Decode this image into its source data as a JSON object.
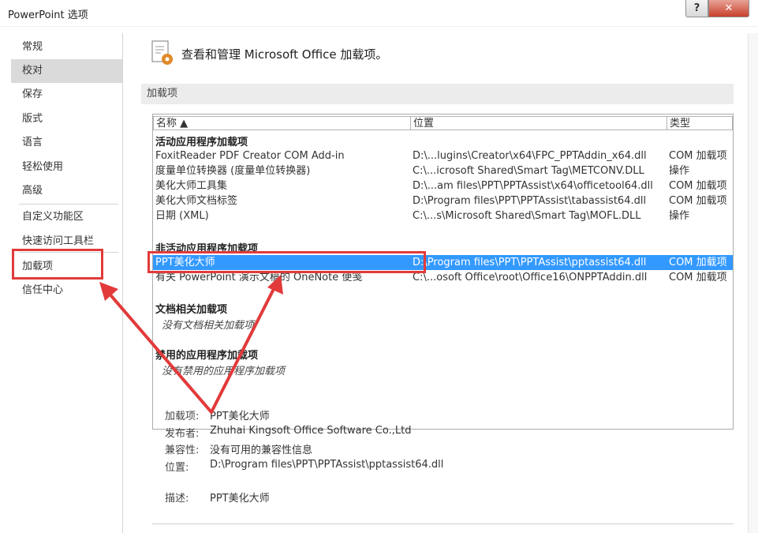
{
  "window": {
    "title": "PowerPoint 选项",
    "help_label": "?",
    "close_label": "✕"
  },
  "nav": {
    "items": [
      {
        "label": "常规"
      },
      {
        "label": "校对"
      },
      {
        "label": "保存"
      },
      {
        "label": "版式"
      },
      {
        "label": "语言"
      },
      {
        "label": "轻松使用"
      },
      {
        "label": "高级"
      },
      {
        "label": "自定义功能区"
      },
      {
        "label": "快速访问工具栏"
      },
      {
        "label": "加载项"
      },
      {
        "label": "信任中心"
      }
    ],
    "active_index": 1
  },
  "main": {
    "header_title": "查看和管理 Microsoft Office 加载项。",
    "section_title": "加载项",
    "columns": {
      "name": "名称 ▲",
      "location": "位置",
      "type": "类型"
    },
    "groups": {
      "active": {
        "label": "活动应用程序加载项",
        "rows": [
          {
            "name": "FoxitReader PDF Creator COM Add-in",
            "location": "D:\\...lugins\\Creator\\x64\\FPC_PPTAddin_x64.dll",
            "type": "COM 加载项"
          },
          {
            "name": "度量单位转换器 (度量单位转换器)",
            "location": "C:\\...icrosoft Shared\\Smart Tag\\METCONV.DLL",
            "type": "操作"
          },
          {
            "name": "美化大师工具集",
            "location": "D:\\...am files\\PPT\\PPTAssist\\x64\\officetool64.dll",
            "type": "COM 加载项"
          },
          {
            "name": "美化大师文档标签",
            "location": "D:\\Program files\\PPT\\PPTAssist\\tabassist64.dll",
            "type": "COM 加载项"
          },
          {
            "name": "日期 (XML)",
            "location": "C:\\...s\\Microsoft Shared\\Smart Tag\\MOFL.DLL",
            "type": "操作"
          }
        ]
      },
      "inactive": {
        "label": "非活动应用程序加载项",
        "rows": [
          {
            "name": "PPT美化大师",
            "location": "D:\\Program files\\PPT\\PPTAssist\\pptassist64.dll",
            "type": "COM 加载项"
          },
          {
            "name": "有关 PowerPoint 演示文稿的 OneNote 便笺",
            "location": "C:\\...osoft Office\\root\\Office16\\ONPPTAddin.dll",
            "type": "COM 加载项"
          }
        ]
      },
      "document": {
        "label": "文档相关加载项",
        "empty_note": "没有文档相关加载项"
      },
      "disabled": {
        "label": "禁用的应用程序加载项",
        "empty_note": "没有禁用的应用程序加载项"
      }
    },
    "details": {
      "addin_label": "加载项:",
      "addin_value": "PPT美化大师",
      "publisher_label": "发布者:",
      "publisher_value": "Zhuhai Kingsoft Office Software Co.,Ltd",
      "compat_label": "兼容性:",
      "compat_value": "没有可用的兼容性信息",
      "location_label": "位置:",
      "location_value": "D:\\Program files\\PPT\\PPTAssist\\pptassist64.dll",
      "desc_label": "描述:",
      "desc_value": "PPT美化大师"
    }
  },
  "colors": {
    "selection": "#3399ff",
    "annotation": "#e23a3a",
    "nav_active": "#dadada"
  }
}
